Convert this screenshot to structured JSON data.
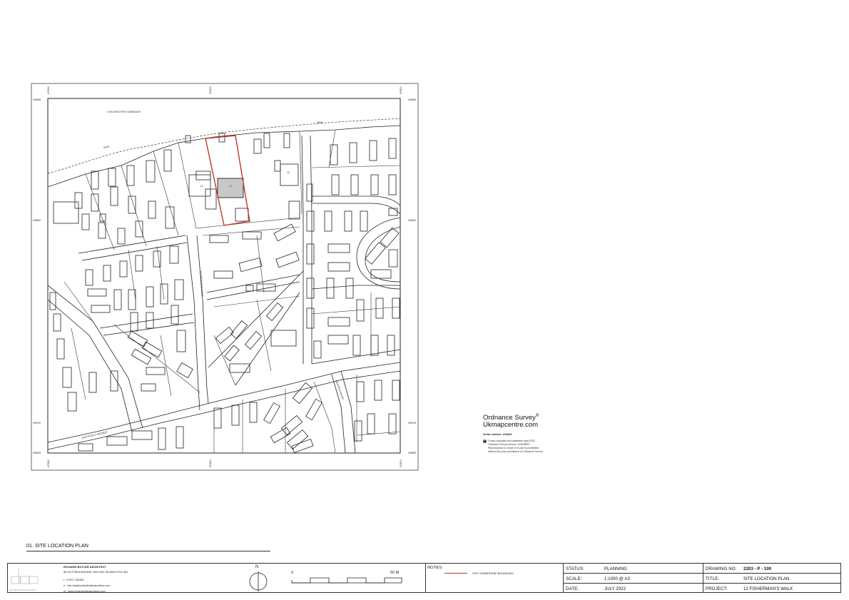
{
  "map": {
    "grid_labels": {
      "top": [
        "474330",
        "474400",
        "474500"
      ],
      "bottom": [
        "474330",
        "474400",
        "474500"
      ],
      "left": [
        "098895",
        "098800",
        "098700",
        "098695"
      ],
      "right": [
        "098895",
        "098800",
        "098700",
        "098695"
      ]
    },
    "place_labels": {
      "harbour": "CHICHESTER HARBOUR",
      "mhw_1": "MHW",
      "mhw_2": "MHW",
      "house_13": "13",
      "house_12": "12",
      "house_15": "15",
      "road_fishermans": "FISHERMAN'S WALK",
      "road_eastfield": "EASTFIELD AVENUE",
      "road_seafield": "SEAFIELD ROAD"
    },
    "boundary_color": "#c0392b",
    "site_fill": "#c8c8c8"
  },
  "os_block": {
    "brand": "Ordnance Survey",
    "mark": "®",
    "site": "Ukmapcentre.com",
    "serial": "Serial number: 244404",
    "copyright_lines": [
      "Crown copyright and database right 2022",
      "Ordnance Survey licence 100048957",
      "Reproduction in whole or in part is prohibited",
      "without the prior permission of Ordnance Survey"
    ]
  },
  "plan_caption": "01. SITE LOCATION PLAN",
  "title_block": {
    "architect": {
      "name": "RICHARD BUTLER ARCHITECT",
      "address": "56 VICTORIA AVENUE, HAYLING ISLAND PO11 9AJ",
      "phone_label": "t:",
      "phone": "07572 782285",
      "email_label": "e:",
      "email": "info.rba@richardbutlerarchitect.com",
      "web_label": "w:",
      "web": "www.richardbutlerarchitect.com",
      "logo_caption": "RICHARD BUTLER ARCHITECT"
    },
    "north": "N",
    "scale_bar": {
      "start": "0",
      "end": "50 M"
    },
    "notes": {
      "heading": "NOTES:",
      "legend_label": "SITE OWNERSHIP BOUNDARY",
      "legend_color": "#c0392b"
    },
    "status_label": "STATUS:",
    "status_value": "PLANNING",
    "scale_label": "SCALE:",
    "scale_value": "1:1000 @ A3",
    "date_label": "DATE:",
    "date_value": "JULY 2022",
    "drawing_no_label": "DRAWING NO:",
    "drawing_no_value": "2203 - P - 100",
    "title_label": "TITLE:",
    "title_value": "SITE LOCATION PLAN",
    "project_label": "PROJECT:",
    "project_value": "12 FISHERMAN'S WALK"
  }
}
